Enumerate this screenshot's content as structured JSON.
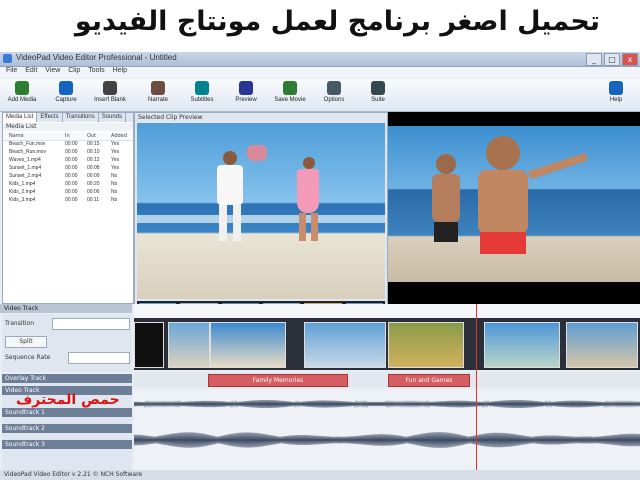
{
  "banner": {
    "title": "تحميل اصغر برنامج لعمل مونتاج الفيديو"
  },
  "window": {
    "title": "VideoPad Video Editor Professional - Untitled",
    "buttons": [
      "_",
      "□",
      "x"
    ]
  },
  "menu": {
    "items": [
      "File",
      "Edit",
      "View",
      "Clip",
      "Tools",
      "Help"
    ]
  },
  "toolbar": {
    "items": [
      {
        "label": "Add Media",
        "color": "#2e7d32"
      },
      {
        "label": "Capture",
        "color": "#1565c0"
      },
      {
        "label": "Insert Blank",
        "color": "#424242"
      },
      {
        "label": "Narrate",
        "color": "#6d4c41"
      },
      {
        "label": "Subtitles",
        "color": "#00838f"
      },
      {
        "label": "Preview",
        "color": "#283593"
      },
      {
        "label": "Save Movie",
        "color": "#2e7d32"
      },
      {
        "label": "Options",
        "color": "#455a64"
      },
      {
        "label": "Suite",
        "color": "#37474f"
      },
      {
        "label": "Help",
        "color": "#1565c0"
      }
    ]
  },
  "left_panel": {
    "tabs": [
      "Media List",
      "Effects",
      "Transitions",
      "Sounds"
    ],
    "list_title": "Media List",
    "columns": [
      "Name",
      "In",
      "Out",
      "Added"
    ],
    "rows": [
      {
        "name": "Beach_Fun.mov",
        "in": "00:00",
        "out": "00:15",
        "added": "Yes"
      },
      {
        "name": "Beach_Run.mov",
        "in": "00:00",
        "out": "00:10",
        "added": "Yes"
      },
      {
        "name": "Waves_1.mp4",
        "in": "00:00",
        "out": "00:12",
        "added": "Yes"
      },
      {
        "name": "Sunset_1.mp4",
        "in": "00:00",
        "out": "00:08",
        "added": "Yes"
      },
      {
        "name": "Sunset_2.mp4",
        "in": "00:00",
        "out": "00:09",
        "added": "No"
      },
      {
        "name": "Kids_1.mp4",
        "in": "00:00",
        "out": "00:20",
        "added": "No"
      },
      {
        "name": "Kids_2.mp4",
        "in": "00:00",
        "out": "00:06",
        "added": "No"
      },
      {
        "name": "Kids_3.mp4",
        "in": "00:00",
        "out": "00:11",
        "added": "No"
      }
    ]
  },
  "preview": {
    "label": "Selected Clip Preview"
  },
  "timeline": {
    "header": "Video Track",
    "controls": [
      "Transition",
      "Split",
      "Sequence Rate"
    ],
    "text_clips": [
      "Family Memories",
      "Fun and Games"
    ],
    "track_labels": [
      "Overlay Track",
      "Video Track",
      "Soundtrack 1",
      "Soundtrack 2",
      "Soundtrack 3"
    ]
  },
  "status": {
    "text": "VideoPad Video Editor v 2.21 © NCH Software"
  },
  "watermark": {
    "text": "حمص المحترف"
  },
  "colors": {
    "accent": "#3a7bd5",
    "text_clip": "#d55e62",
    "playhead": "#dd3333"
  }
}
